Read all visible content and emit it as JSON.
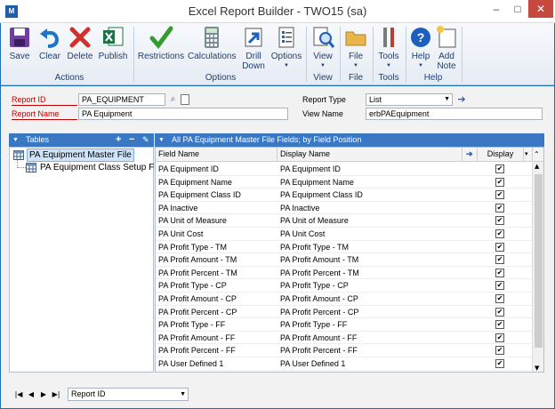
{
  "window": {
    "title": "Excel Report Builder  -  TWO15 (sa)",
    "min": "–",
    "max": "□",
    "close": "✕",
    "app_icon_text": "M"
  },
  "ribbon": {
    "buttons": {
      "save": "Save",
      "clear": "Clear",
      "delete": "Delete",
      "publish": "Publish",
      "restrictions": "Restrictions",
      "calculations": "Calculations",
      "drill_down_1": "Drill",
      "drill_down_2": "Down",
      "options": "Options",
      "view": "View",
      "file": "File",
      "tools": "Tools",
      "help": "Help",
      "add_note_1": "Add",
      "add_note_2": "Note"
    },
    "groups": {
      "actions": "Actions",
      "options": "Options",
      "view": "View",
      "file": "File",
      "tools": "Tools",
      "help": "Help"
    }
  },
  "form": {
    "report_id_label": "Report ID",
    "report_id_value": "PA_EQUIPMENT",
    "report_name_label": "Report Name",
    "report_name_value": "PA Equipment",
    "report_type_label": "Report Type",
    "report_type_value": "List",
    "view_name_label": "View Name",
    "view_name_value": "erbPAEquipment"
  },
  "tables_pane": {
    "header": "Tables",
    "add": "+",
    "remove": "−",
    "items": [
      "PA Equipment Master File",
      "PA Equipment Class Setup File"
    ]
  },
  "grid": {
    "header": "All PA Equipment Master File Fields; by Field Position",
    "columns": {
      "field_name": "Field Name",
      "display_name": "Display Name",
      "display": "Display"
    },
    "rows": [
      [
        "PA Equipment ID",
        "PA Equipment ID"
      ],
      [
        "PA Equipment Name",
        "PA Equipment Name"
      ],
      [
        "PA Equipment Class ID",
        "PA Equipment Class ID"
      ],
      [
        "PA Inactive",
        "PA Inactive"
      ],
      [
        "PA Unit of Measure",
        "PA Unit of Measure"
      ],
      [
        "PA Unit Cost",
        "PA Unit Cost"
      ],
      [
        "PA Profit Type - TM",
        "PA Profit Type - TM"
      ],
      [
        "PA Profit Amount - TM",
        "PA Profit Amount - TM"
      ],
      [
        "PA Profit Percent - TM",
        "PA Profit Percent - TM"
      ],
      [
        "PA Profit Type - CP",
        "PA Profit Type - CP"
      ],
      [
        "PA Profit Amount - CP",
        "PA Profit Amount - CP"
      ],
      [
        "PA Profit Percent - CP",
        "PA Profit Percent - CP"
      ],
      [
        "PA Profit Type - FF",
        "PA Profit Type - FF"
      ],
      [
        "PA Profit Amount - FF",
        "PA Profit Amount - FF"
      ],
      [
        "PA Profit Percent - FF",
        "PA Profit Percent - FF"
      ],
      [
        "PA User Defined 1",
        "PA User Defined 1"
      ]
    ],
    "check_mark": "✔"
  },
  "bottom": {
    "sort_value": "Report ID",
    "first": "|◀",
    "prev": "◀",
    "next": "▶",
    "last": "▶|"
  },
  "colors": {
    "accent": "#3a78c3",
    "required_label": "#c00000",
    "frame": "#1f6fb5"
  }
}
